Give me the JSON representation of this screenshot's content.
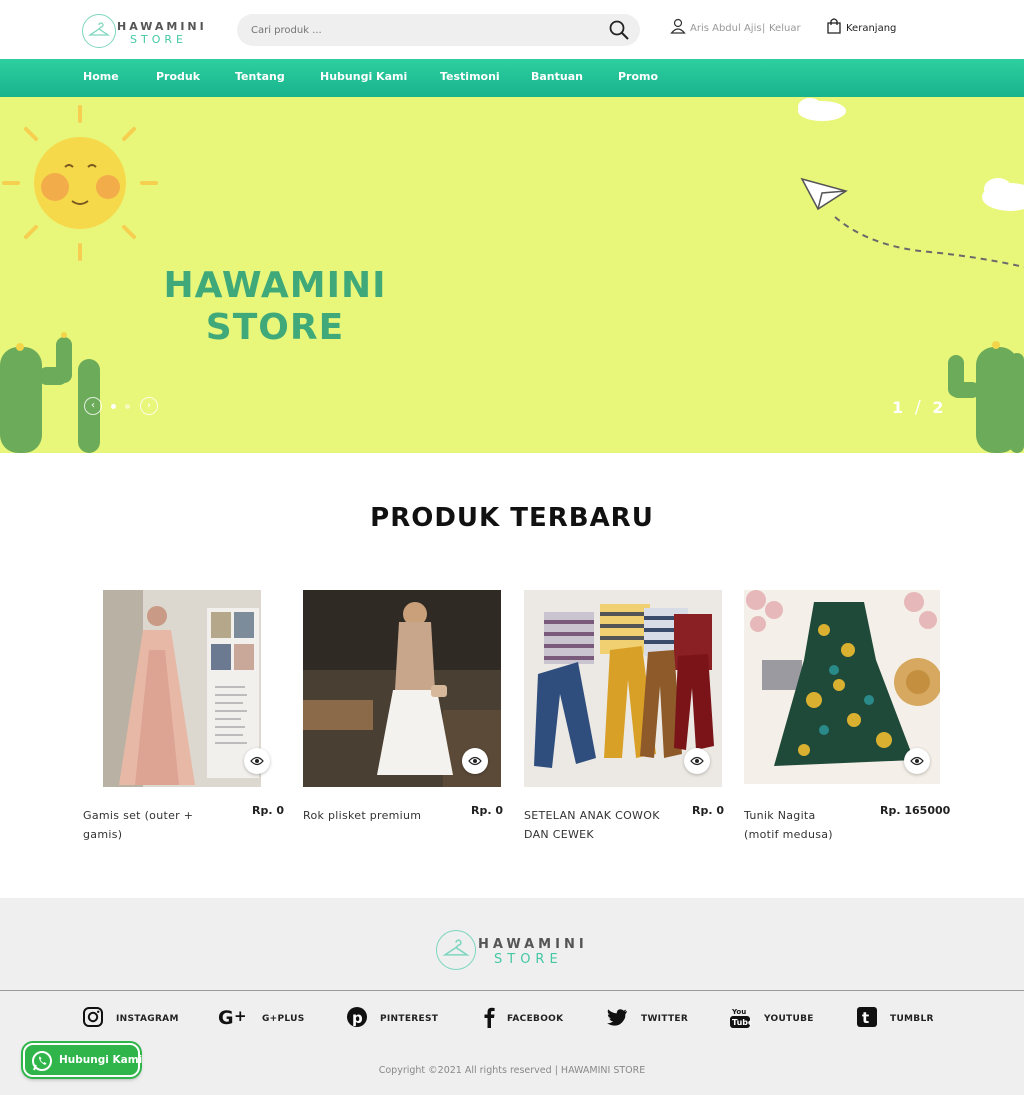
{
  "brand": {
    "line1": "HAWAMINI",
    "line2": "STORE"
  },
  "search": {
    "placeholder": "Cari produk ..."
  },
  "user": {
    "name": "Aris Abdul Ajis",
    "separator": "|",
    "logout": "Keluar"
  },
  "cart": {
    "label": "Keranjang"
  },
  "nav": [
    "Home",
    "Produk",
    "Tentang",
    "Hubungi Kami",
    "Testimoni",
    "Bantuan",
    "Promo"
  ],
  "banner": {
    "title_line1": "HAWAMINI",
    "title_line2": "STORE",
    "current_slide": "1",
    "separator": "/",
    "total_slides": "2",
    "bg_color": "#e8f67a"
  },
  "section": {
    "title": "PRODUK TERBARU"
  },
  "products": [
    {
      "name": "Gamis set (outer + gamis)",
      "price": "Rp. 0"
    },
    {
      "name": "Rok plisket premium",
      "price": "Rp. 0"
    },
    {
      "name": "SETELAN ANAK COWOK DAN CEWEK",
      "price": "Rp. 0"
    },
    {
      "name": "Tunik Nagita (motif medusa)",
      "price": "Rp. 165000"
    }
  ],
  "footer": {
    "brand_line1": "HAWAMINI",
    "brand_line2": "STORE",
    "social": [
      {
        "label": "INSTAGRAM",
        "icon": "instagram-icon"
      },
      {
        "label": "G+PLUS",
        "icon": "google-plus-icon"
      },
      {
        "label": "PINTEREST",
        "icon": "pinterest-icon"
      },
      {
        "label": "FACEBOOK",
        "icon": "facebook-icon"
      },
      {
        "label": "TWITTER",
        "icon": "twitter-icon"
      },
      {
        "label": "YOUTUBE",
        "icon": "youtube-icon"
      },
      {
        "label": "TUMBLR",
        "icon": "tumblr-icon"
      }
    ],
    "copyright": "Copyright ©2021 All rights reserved | HAWAMINI STORE"
  },
  "whatsapp": {
    "label": "Hubungi Kami"
  },
  "colors": {
    "accent": "#1fbf93",
    "whatsapp": "#2fb54a"
  }
}
